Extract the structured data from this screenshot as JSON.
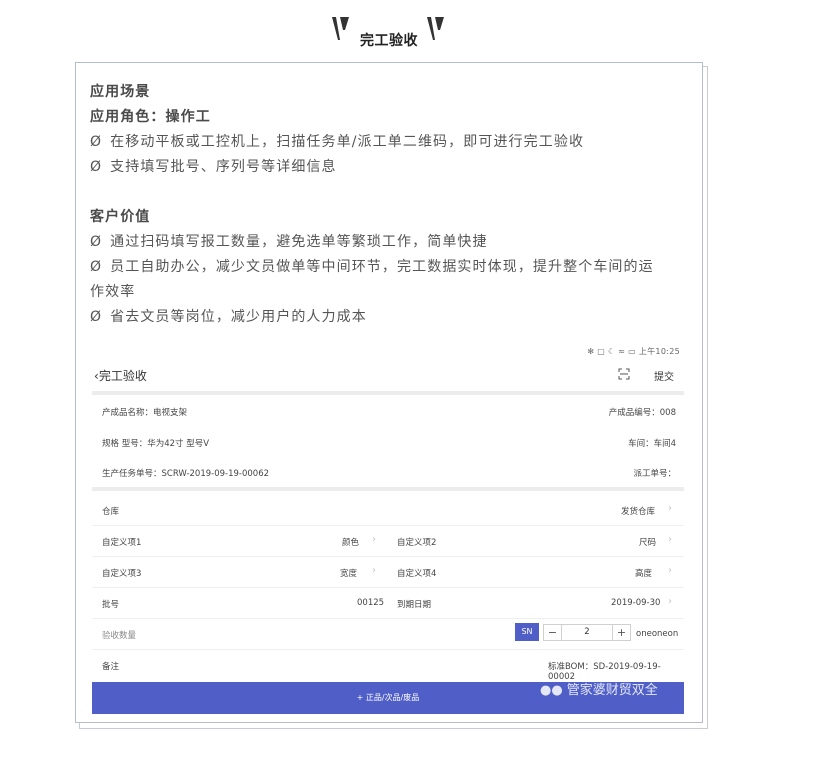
{
  "heading": {
    "title": "完工验收"
  },
  "intro": {
    "scene_title": "应用场景",
    "role_line": "应用角色：操作工",
    "scene_items": [
      "在移动平板或工控机上，扫描任务单/派工单二维码，即可进行完工验收",
      "支持填写批号、序列号等详细信息"
    ],
    "value_title": "客户价值",
    "value_items": [
      "通过扫码填写报工数量，避免选单等繁琐工作，简单快捷",
      "员工自助办公，减少文员做单等中间环节，完工数据实时体现，提升整个车间的运",
      "作效率",
      "省去文员等岗位，减少用户的人力成本"
    ],
    "bullet_symbol": "Ø"
  },
  "phone": {
    "statusbar": "✻ ▢ ☾ ≈ ▭ 上午10:25",
    "appbar": {
      "back_label": "完工验收",
      "submit_label": "提交"
    },
    "info": {
      "product_name": "产成品名称：电视支架",
      "product_code": "产成品编号：008",
      "spec": "规格 型号：华为42寸 型号V",
      "workshop": "车间：车间4",
      "task_no": "生产任务单号：SCRW-2019-09-19-00062",
      "dispatch_no": "派工单号："
    },
    "form": {
      "warehouse_label": "仓库",
      "warehouse_value": "发货仓库",
      "custom1_label": "自定义项1",
      "custom1_value": "颜色",
      "custom2_label": "自定义项2",
      "custom2_value": "尺码",
      "custom3_label": "自定义项3",
      "custom3_value": "宽度",
      "custom4_label": "自定义项4",
      "custom4_value": "高度",
      "batch_label": "批号",
      "batch_value": "00125",
      "expiry_label": "到期日期",
      "expiry_value": "2019-09-30",
      "qty_label": "验收数量",
      "sn_label": "SN",
      "qty_value": "2",
      "qty_unit": "oneoneon",
      "remark_label": "备注",
      "bom_value": "标准BOM：SD-2019-09-19-00002"
    },
    "bottom_button": "+ 正品/次品/废品",
    "watermark": "管家婆财贸双全"
  },
  "colors": {
    "accent": "#4f5fc7",
    "frame": "#b5bccb"
  }
}
